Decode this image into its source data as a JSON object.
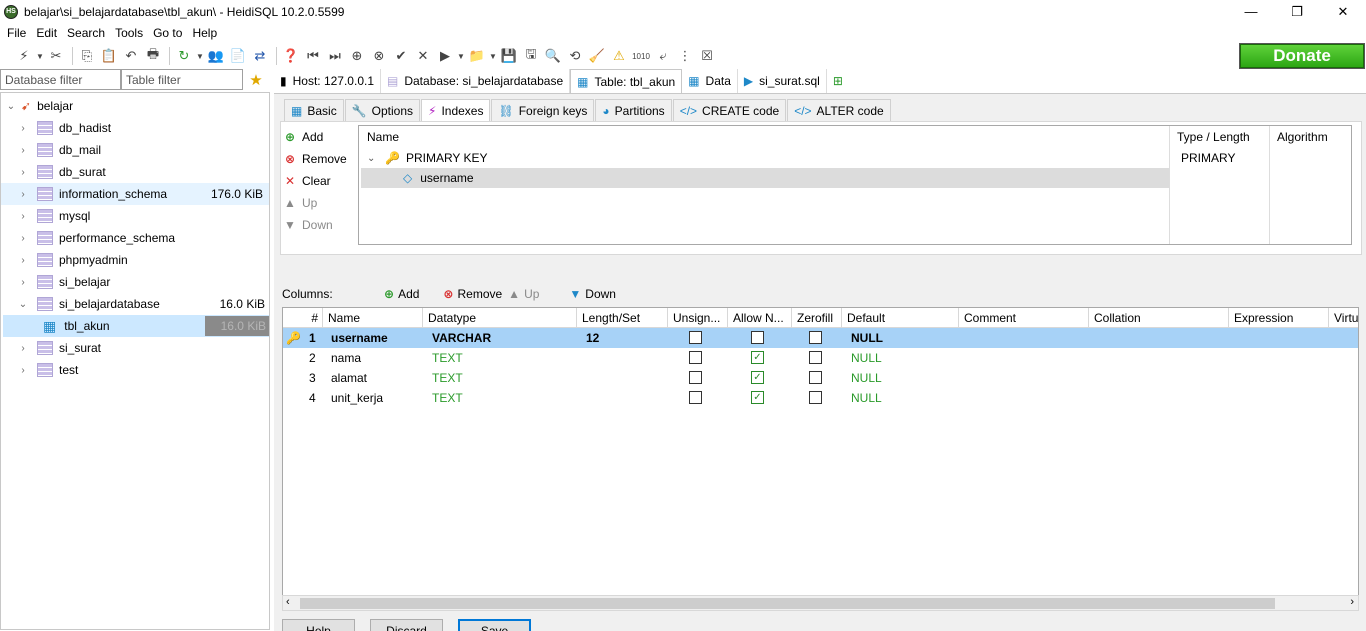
{
  "window": {
    "title": "belajar\\si_belajardatabase\\tbl_akun\\ - HeidiSQL 10.2.0.5599",
    "logo_text": "HS",
    "controls": {
      "minimize": "—",
      "restore": "❐",
      "close": "✕"
    }
  },
  "menu": [
    "File",
    "Edit",
    "Search",
    "Tools",
    "Go to",
    "Help"
  ],
  "toolbar": {
    "donate_label": "Donate"
  },
  "filters": {
    "database_filter": "Database filter",
    "table_filter": "Table filter"
  },
  "tree": {
    "root": "belajar",
    "databases": [
      {
        "name": "db_hadist",
        "size": ""
      },
      {
        "name": "db_mail",
        "size": ""
      },
      {
        "name": "db_surat",
        "size": ""
      },
      {
        "name": "information_schema",
        "size": "176.0 KiB"
      },
      {
        "name": "mysql",
        "size": ""
      },
      {
        "name": "performance_schema",
        "size": ""
      },
      {
        "name": "phpmyadmin",
        "size": ""
      },
      {
        "name": "si_belajar",
        "size": ""
      },
      {
        "name": "si_belajardatabase",
        "size": "16.0 KiB"
      },
      {
        "name": "tbl_akun",
        "size": "16.0 KiB"
      },
      {
        "name": "si_surat",
        "size": ""
      },
      {
        "name": "test",
        "size": ""
      }
    ]
  },
  "doc_tabs": [
    "Host: 127.0.0.1",
    "Database: si_belajardatabase",
    "Table: tbl_akun",
    "Data",
    "si_surat.sql"
  ],
  "sub_tabs": [
    "Basic",
    "Options",
    "Indexes",
    "Foreign keys",
    "Partitions",
    "CREATE code",
    "ALTER code"
  ],
  "index_buttons": [
    "Add",
    "Remove",
    "Clear",
    "Up",
    "Down"
  ],
  "index_grid": {
    "headers": [
      "Name",
      "Type / Length",
      "Algorithm"
    ],
    "key_name": "PRIMARY KEY",
    "key_type": "PRIMARY",
    "key_column": "username"
  },
  "columns_bar": {
    "label": "Columns:",
    "add": "Add",
    "remove": "Remove",
    "up": "Up",
    "down": "Down"
  },
  "columns_grid": {
    "headers": [
      "#",
      "Name",
      "Datatype",
      "Length/Set",
      "Unsign...",
      "Allow N...",
      "Zerofill",
      "Default",
      "Comment",
      "Collation",
      "Expression",
      "Virtu"
    ],
    "rows": [
      {
        "num": "1",
        "name": "username",
        "datatype": "VARCHAR",
        "length": "12",
        "unsigned": false,
        "allow_null": false,
        "zerofill": false,
        "default": "NULL"
      },
      {
        "num": "2",
        "name": "nama",
        "datatype": "TEXT",
        "length": "",
        "unsigned": false,
        "allow_null": true,
        "zerofill": false,
        "default": "NULL"
      },
      {
        "num": "3",
        "name": "alamat",
        "datatype": "TEXT",
        "length": "",
        "unsigned": false,
        "allow_null": true,
        "zerofill": false,
        "default": "NULL"
      },
      {
        "num": "4",
        "name": "unit_kerja",
        "datatype": "TEXT",
        "length": "",
        "unsigned": false,
        "allow_null": true,
        "zerofill": false,
        "default": "NULL"
      }
    ]
  },
  "bottom_buttons": {
    "help": "Help",
    "discard": "Discard",
    "save": "Save"
  }
}
